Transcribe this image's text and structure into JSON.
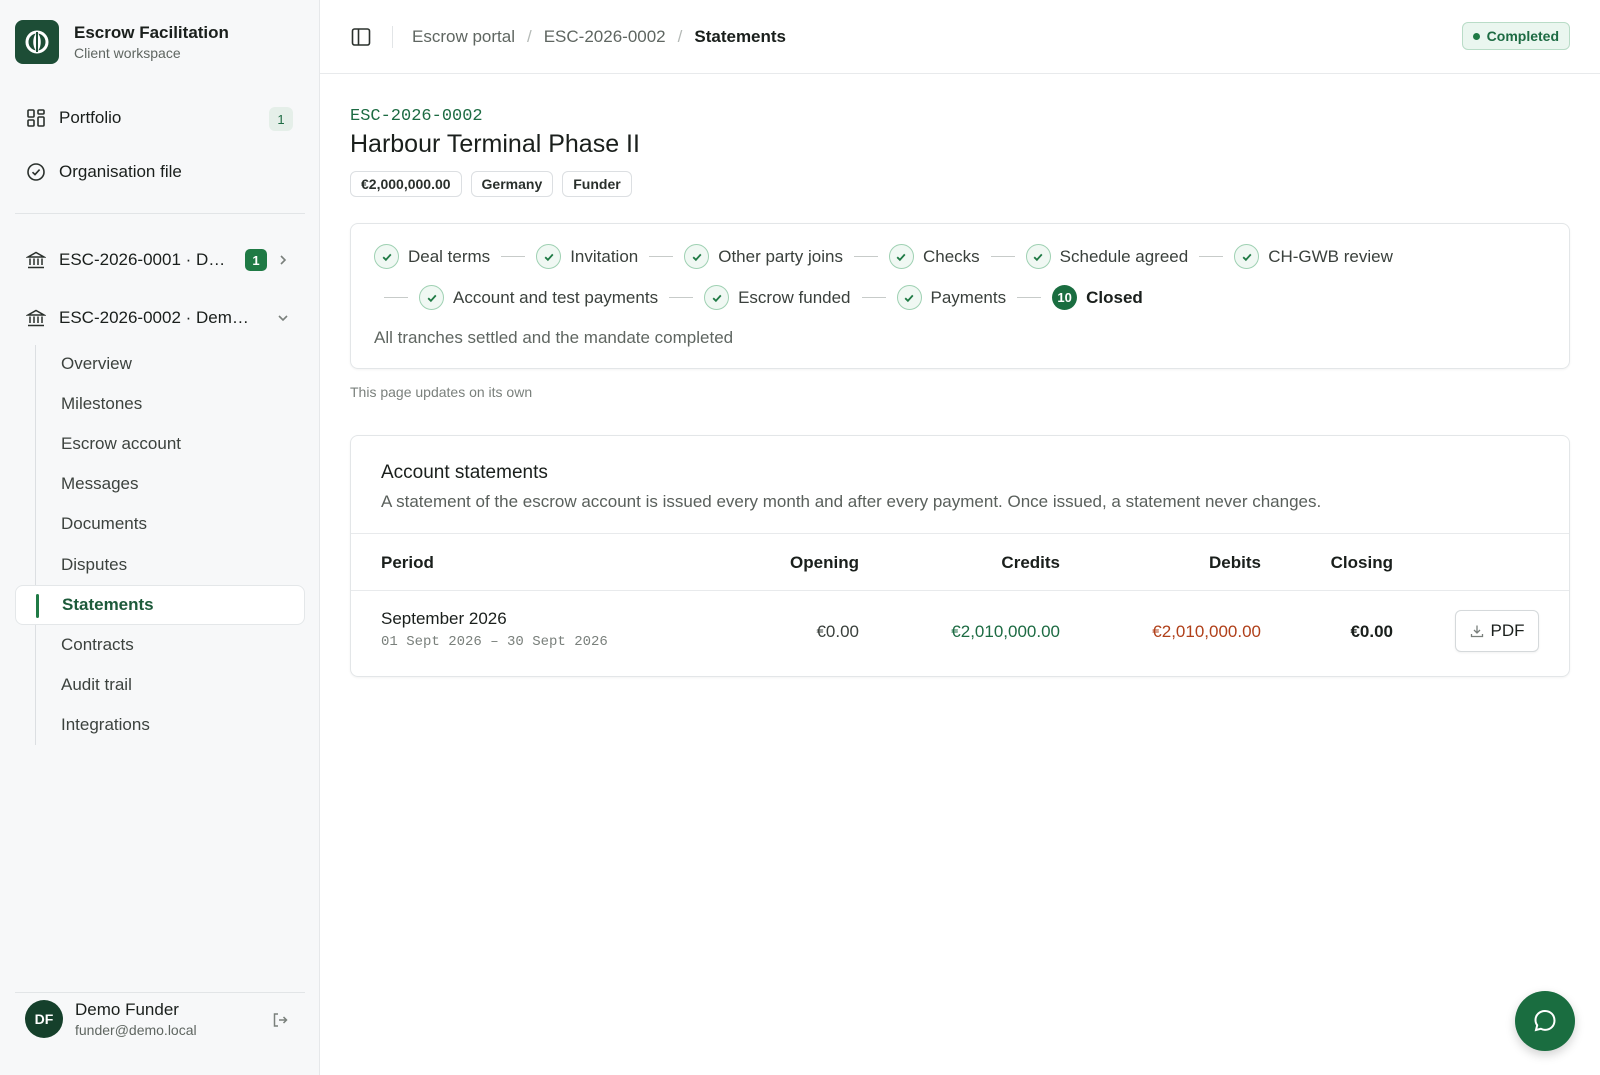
{
  "brand": {
    "title": "Escrow Facilitation",
    "subtitle": "Client workspace"
  },
  "sidebar": {
    "nav": [
      {
        "label": "Portfolio",
        "icon": "grid-icon",
        "count": "1"
      },
      {
        "label": "Organisation file",
        "icon": "check-circle-icon"
      }
    ],
    "deals": [
      {
        "label": "ESC-2026-0001 · D…",
        "icon": "bank-icon",
        "badge": "1",
        "chevron": "chevron-right-icon"
      },
      {
        "label": "ESC-2026-0002 · Dem…",
        "icon": "bank-icon",
        "chevron": "chevron-down-icon"
      }
    ],
    "sub_items": [
      "Overview",
      "Milestones",
      "Escrow account",
      "Messages",
      "Documents",
      "Disputes",
      "Statements",
      "Contracts",
      "Audit trail",
      "Integrations"
    ],
    "active_sub": "Statements",
    "user": {
      "initials": "DF",
      "name": "Demo Funder",
      "email": "funder@demo.local"
    }
  },
  "header": {
    "breadcrumbs": [
      "Escrow portal",
      "ESC-2026-0002",
      "Statements"
    ],
    "status": "Completed"
  },
  "deal": {
    "code": "ESC-2026-0002",
    "title": "Harbour Terminal Phase II",
    "tags": [
      "€2,000,000.00",
      "Germany",
      "Funder"
    ]
  },
  "progress": {
    "row1": [
      "Deal terms",
      "Invitation",
      "Other party joins",
      "Checks",
      "Schedule agreed",
      "CH-GWB review"
    ],
    "row2": [
      "Account and test payments",
      "Escrow funded",
      "Payments"
    ],
    "current_number": "10",
    "current_label": "Closed",
    "note": "All tranches settled and the mandate completed"
  },
  "updates_note": "This page updates on its own",
  "statements": {
    "title": "Account statements",
    "description": "A statement of the escrow account is issued every month and after every payment. Once issued, a statement never changes.",
    "columns": {
      "period": "Period",
      "opening": "Opening",
      "credits": "Credits",
      "debits": "Debits",
      "closing": "Closing"
    },
    "rows": [
      {
        "period": "September 2026",
        "range": "01 Sept 2026 – 30 Sept 2026",
        "opening": "€0.00",
        "credits": "€2,010,000.00",
        "debits": "€2,010,000.00",
        "closing": "€0.00",
        "action": "PDF"
      }
    ]
  },
  "colors": {
    "brand": "#1d4d36",
    "accent": "#1f7a45",
    "credit": "#1d6b43",
    "debit": "#b0401a"
  }
}
